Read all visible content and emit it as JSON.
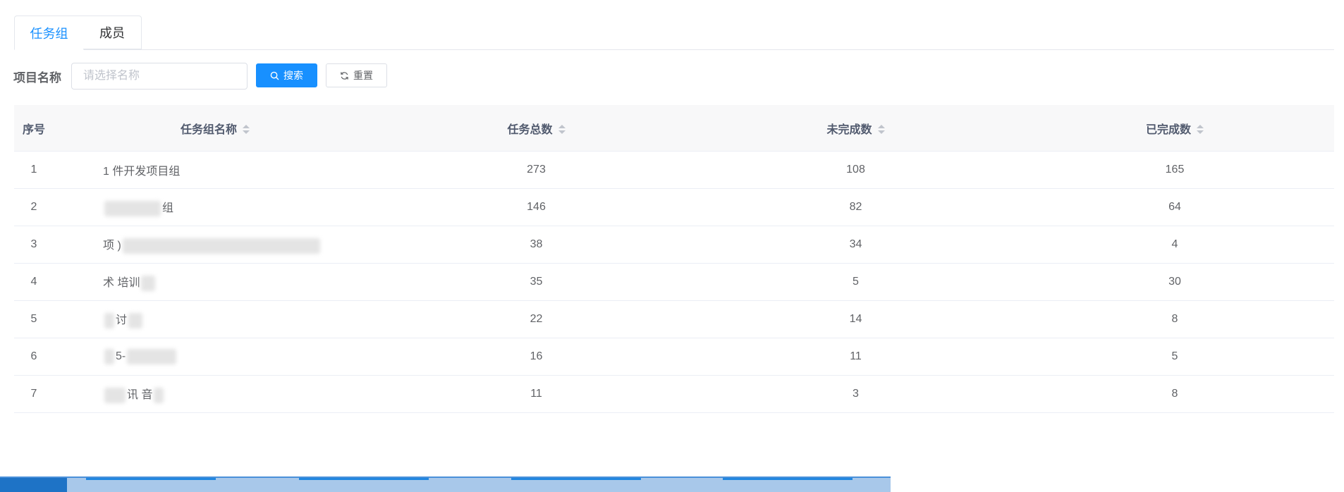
{
  "tabs": [
    {
      "label": "任务组",
      "active": true
    },
    {
      "label": "成员",
      "active": false
    }
  ],
  "search": {
    "label": "项目名称",
    "placeholder": "请选择名称",
    "search_button": "搜索",
    "reset_button": "重置"
  },
  "table": {
    "columns": [
      "序号",
      "任务组名称",
      "任务总数",
      "未完成数",
      "已完成数"
    ],
    "rows": [
      {
        "index": "1",
        "name": "1 件开发项目组",
        "total": "273",
        "incomplete": "108",
        "complete": "165"
      },
      {
        "index": "2",
        "name": "组",
        "total": "146",
        "incomplete": "82",
        "complete": "64"
      },
      {
        "index": "3",
        "name": "项 )",
        "total": "38",
        "incomplete": "34",
        "complete": "4"
      },
      {
        "index": "4",
        "name": "术 培训",
        "total": "35",
        "incomplete": "5",
        "complete": "30"
      },
      {
        "index": "5",
        "name": "讨",
        "total": "22",
        "incomplete": "14",
        "complete": "8"
      },
      {
        "index": "6",
        "name": "5-",
        "total": "16",
        "incomplete": "11",
        "complete": "5"
      },
      {
        "index": "7",
        "name": "讯 音",
        "total": "11",
        "incomplete": "3",
        "complete": "8"
      }
    ]
  },
  "colors": {
    "primary": "#1890ff",
    "header_bg": "#f8f8f9",
    "border": "#ebeef5"
  }
}
